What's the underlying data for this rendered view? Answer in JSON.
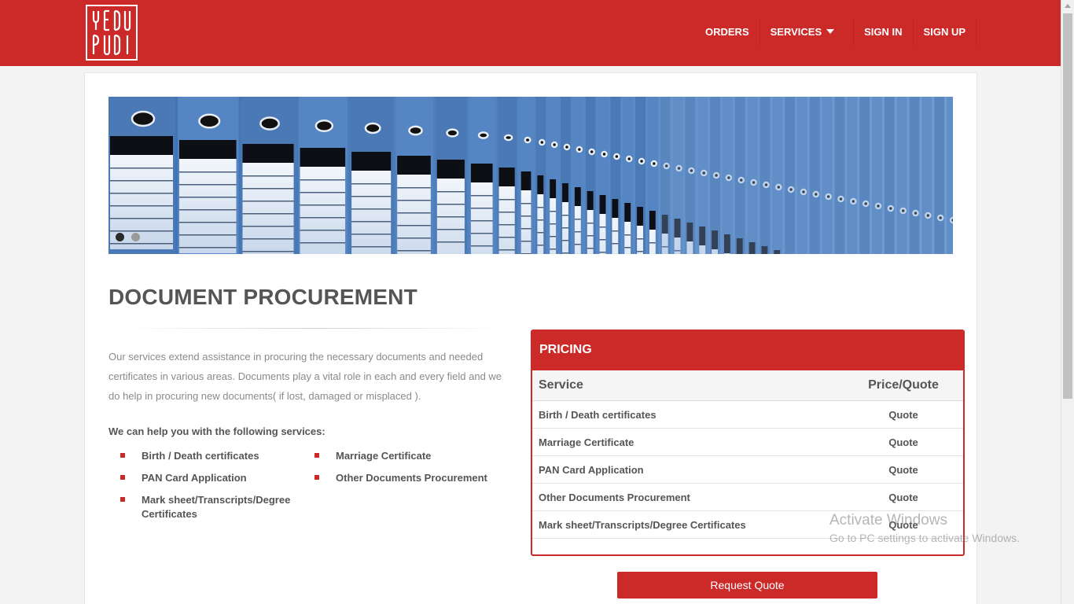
{
  "brand": {
    "logo_text": "YEDUPUDI"
  },
  "nav": {
    "orders": "ORDERS",
    "services": "SERVICES",
    "sign_in": "SIGN IN",
    "sign_up": "SIGN UP"
  },
  "page": {
    "title": "DOCUMENT PROCUREMENT",
    "intro": "Our services extend assistance in procuring the necessary documents and needed certificates in various areas. Documents play a vital role in each and every field and we do help in procuring new documents( if lost, damaged or misplaced ).",
    "help_heading": "We can help you with the following services:",
    "services": [
      "Birth / Death certificates",
      "Marriage Certificate",
      "PAN Card Application",
      "Other Documents Procurement",
      "Mark sheet/Transcripts/Degree Certificates"
    ]
  },
  "pricing": {
    "title": "PRICING",
    "col_service": "Service",
    "col_price": "Price/Quote",
    "rows": [
      {
        "service": "Birth / Death certificates",
        "price": "Quote"
      },
      {
        "service": "Marriage Certificate",
        "price": "Quote"
      },
      {
        "service": "PAN Card Application",
        "price": "Quote"
      },
      {
        "service": "Other Documents Procurement",
        "price": "Quote"
      },
      {
        "service": "Mark sheet/Transcripts/Degree Certificates",
        "price": "Quote"
      }
    ]
  },
  "cta": {
    "request_quote": "Request Quote"
  },
  "watermark": {
    "line1": "Activate Windows",
    "line2": "Go to PC settings to activate Windows."
  },
  "colors": {
    "brand_red": "#cc2a29",
    "text_dark": "#555555",
    "text_muted": "#8a8a8a"
  }
}
